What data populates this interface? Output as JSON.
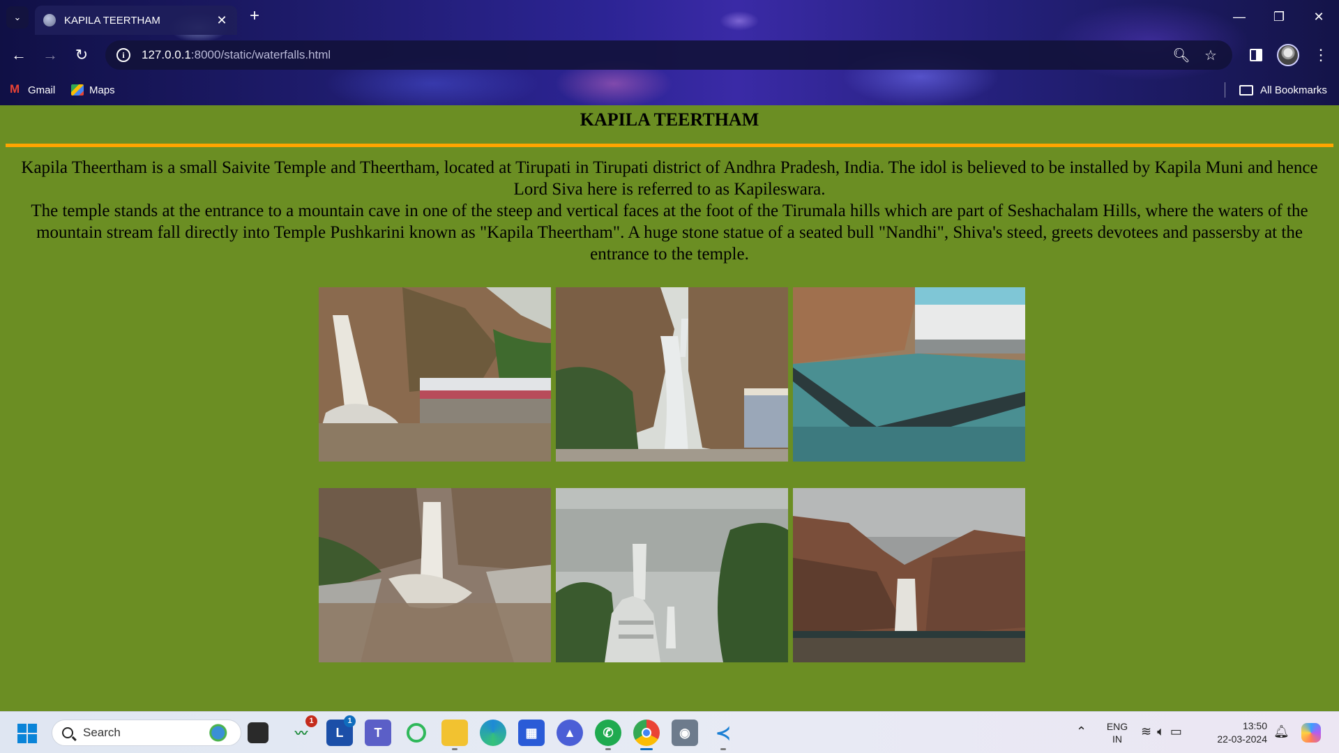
{
  "browser": {
    "tab": {
      "title": "KAPILA TEERTHAM",
      "favicon": "globe-icon"
    },
    "url": {
      "host": "127.0.0.1",
      "path": ":8000/static/waterfalls.html"
    },
    "bookmarks": [
      {
        "label": "Gmail",
        "icon": "gmail-icon"
      },
      {
        "label": "Maps",
        "icon": "maps-icon"
      }
    ],
    "all_bookmarks_label": "All Bookmarks"
  },
  "page": {
    "background": "#6b8e23",
    "rule_color": "#ffa500",
    "title": "KAPILA TEERTHAM",
    "paragraph_1": "Kapila Theertham is a small Saivite Temple and Theertham, located at Tirupati in Tirupati district of Andhra Pradesh, India. The idol is believed to be installed by Kapila Muni and hence Lord Siva here is referred to as Kapileswara.",
    "paragraph_2": "The temple stands at the entrance to a mountain cave in one of the steep and vertical faces at the foot of the Tirumala hills which are part of Seshachalam Hills, where the waters of the mountain stream fall directly into Temple Pushkarini known as \"Kapila Theertham\". A huge stone statue of a seated bull \"Nandhi\", Shiva's steed, greets devotees and passersby at the entrance to the temple.",
    "photos": [
      "waterfall-with-temple-corridor",
      "waterfall-between-cliffs",
      "temple-pushkarini-pond",
      "waterfall-flood-corridors",
      "temple-gopuram-in-mist",
      "waterfall-under-cloudy-sky"
    ]
  },
  "taskbar": {
    "search_placeholder": "Search",
    "apps": [
      {
        "name": "file-explorer-dark-icon",
        "badge": ""
      },
      {
        "name": "stocks-app-icon",
        "badge": "1"
      },
      {
        "name": "l-app-icon",
        "badge": "1"
      },
      {
        "name": "teams-icon",
        "badge": ""
      },
      {
        "name": "green-ring-app-icon",
        "badge": ""
      },
      {
        "name": "file-explorer-icon",
        "badge": ""
      },
      {
        "name": "edge-icon",
        "badge": ""
      },
      {
        "name": "store-icon",
        "badge": ""
      },
      {
        "name": "triangle-app-icon",
        "badge": ""
      },
      {
        "name": "whatsapp-icon",
        "badge": ""
      },
      {
        "name": "chrome-icon",
        "badge": ""
      },
      {
        "name": "camera-icon",
        "badge": ""
      },
      {
        "name": "vscode-icon",
        "badge": ""
      }
    ],
    "lang_line1": "ENG",
    "lang_line2": "IN",
    "time": "13:50",
    "date": "22-03-2024"
  }
}
